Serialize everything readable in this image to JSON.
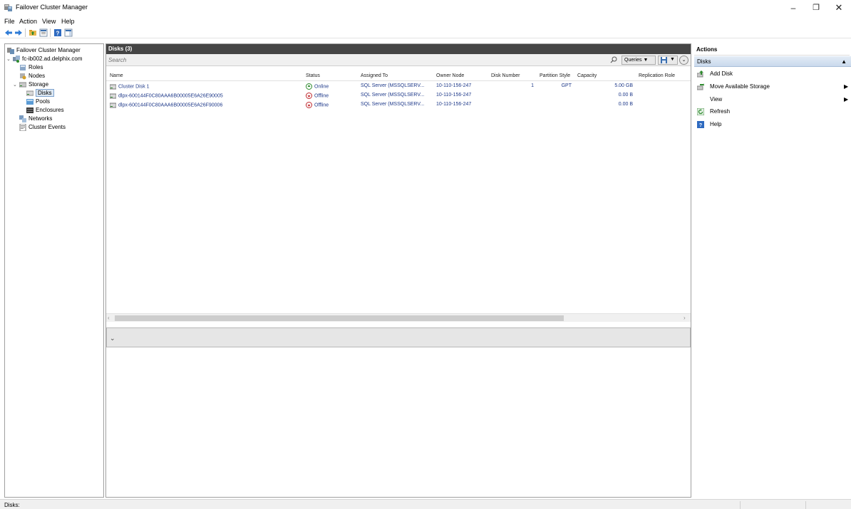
{
  "window": {
    "title": "Failover Cluster Manager",
    "minimize_glyph": "–",
    "maximize_glyph": "❐",
    "close_glyph": "✕"
  },
  "menu": [
    "File",
    "Action",
    "View",
    "Help"
  ],
  "toolbar": {
    "buttons": [
      "back-arrow-icon",
      "forward-arrow-icon",
      "folder-up-icon",
      "properties-icon",
      "help-icon",
      "show-hide-pane-icon"
    ]
  },
  "tree": {
    "root": "Failover Cluster Manager",
    "cluster": "fc-ib002.ad.delphix.com",
    "roles": "Roles",
    "nodes": "Nodes",
    "storage": "Storage",
    "disks": "Disks",
    "pools": "Pools",
    "enclosures": "Enclosures",
    "networks": "Networks",
    "cluster_events": "Cluster Events"
  },
  "center": {
    "header": "Disks (3)",
    "search_placeholder": "Search",
    "queries_label": "Queries",
    "dropdown_glyph": "▼",
    "collapse_glyph": "⌄",
    "columns": [
      "Name",
      "Status",
      "Assigned To",
      "Owner Node",
      "Disk Number",
      "Partition Style",
      "Capacity",
      "Replication Role"
    ],
    "rows": [
      {
        "name": "Cluster Disk 1",
        "status": "Online",
        "status_color": "#2e8b2e",
        "assigned_to": "SQL Server (MSSQLSERV...",
        "owner_node": "10-110-156-247",
        "disk_number": "1",
        "partition_style": "GPT",
        "capacity": "5.00 GB",
        "replication_role": ""
      },
      {
        "name": "dlpx-600144F0C80AAA6B00005E6A26E90005",
        "status": "Offline",
        "status_color": "#c0282d",
        "assigned_to": "SQL Server (MSSQLSERV...",
        "owner_node": "10-110-156-247",
        "disk_number": "",
        "partition_style": "",
        "capacity": "0.00 B",
        "replication_role": ""
      },
      {
        "name": "dlpx-600144F0C80AAA6B00005E6A26F90006",
        "status": "Offline",
        "status_color": "#c0282d",
        "assigned_to": "SQL Server (MSSQLSERV...",
        "owner_node": "10-110-156-247",
        "disk_number": "",
        "partition_style": "",
        "capacity": "0.00 B",
        "replication_role": ""
      }
    ],
    "scroll_left_glyph": "‹",
    "scroll_right_glyph": "›",
    "detail_chevron": "⌄"
  },
  "actions": {
    "title": "Actions",
    "section": "Disks",
    "section_chevron": "▲",
    "items": [
      {
        "label": "Add Disk",
        "icon": "add-disk-icon",
        "submenu": false
      },
      {
        "label": "Move Available Storage",
        "icon": "move-storage-icon",
        "submenu": true
      },
      {
        "label": "View",
        "icon": "",
        "submenu": true
      },
      {
        "label": "Refresh",
        "icon": "refresh-icon",
        "submenu": false
      },
      {
        "label": "Help",
        "icon": "help-icon",
        "submenu": false
      }
    ],
    "submenu_glyph": "▶"
  },
  "statusbar": {
    "text": "Disks:"
  },
  "colors": {
    "header_bg": "#454545",
    "link_text": "#1f3a8a",
    "actions_section_bg": "#c9d9ec"
  }
}
